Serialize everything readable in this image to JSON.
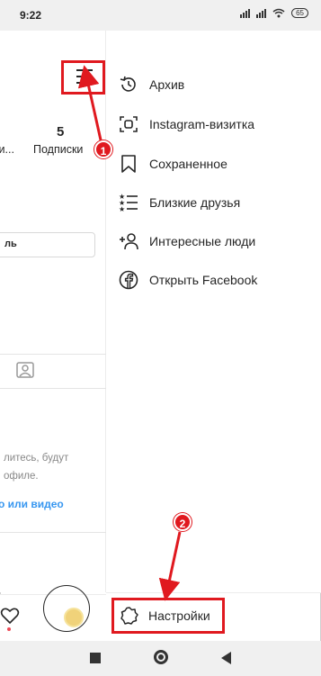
{
  "statusbar": {
    "time": "9:22",
    "battery": "65"
  },
  "profile": {
    "stat_number": "5",
    "stat_label_partial": "чи...",
    "stat_label_following": "Подписки",
    "edit_button_partial": "ль",
    "hint_line1": "литесь, будут",
    "hint_line2": "офиле.",
    "link_text": "о или видео"
  },
  "drawer": {
    "items": [
      {
        "label": "Архив",
        "icon": "archive-history-icon"
      },
      {
        "label": "Instagram-визитка",
        "icon": "nametag-icon"
      },
      {
        "label": "Сохраненное",
        "icon": "bookmark-icon"
      },
      {
        "label": "Близкие друзья",
        "icon": "close-friends-list-icon"
      },
      {
        "label": "Интересные люди",
        "icon": "add-person-icon"
      },
      {
        "label": "Открыть Facebook",
        "icon": "facebook-icon"
      }
    ],
    "settings_label": "Настройки"
  },
  "annotations": {
    "step1": "1",
    "step2": "2",
    "color": "#e0191f"
  },
  "colors": {
    "accent_link": "#3897f0",
    "annotation_red": "#e0191f"
  }
}
